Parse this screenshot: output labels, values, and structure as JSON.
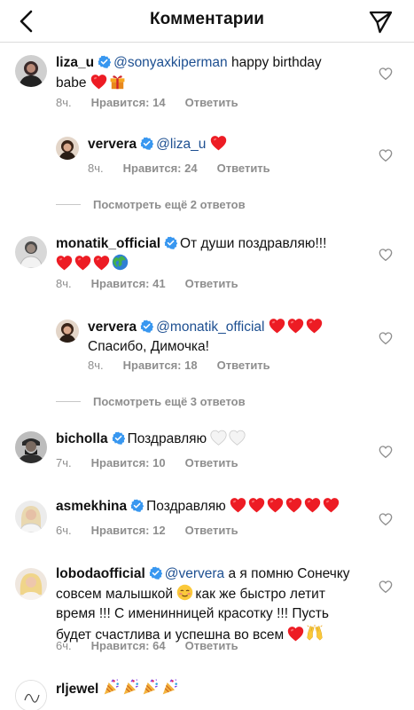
{
  "header": {
    "title": "Комментарии",
    "back_icon": "back-arrow-icon",
    "send_icon": "paper-plane-icon"
  },
  "comments": [
    {
      "username": "liza_u",
      "mention": "@sonyaxkiperman",
      "text": "happy birthday",
      "text2": "babe",
      "time": "8ч.",
      "likes": "Нравится: 14",
      "reply": "Ответить"
    },
    {
      "username": "ververa",
      "mention": "@liza_u",
      "time": "8ч.",
      "likes": "Нравится: 24",
      "reply": "Ответить"
    },
    {
      "view_more": "Посмотреть ещё 2 ответов"
    },
    {
      "username": "monatik_official",
      "text": "От души поздравляю!!!",
      "time": "8ч.",
      "likes": "Нравится: 41",
      "reply": "Ответить"
    },
    {
      "username": "ververa",
      "mention": "@monatik_official",
      "text2": "Спасибо, Димочка!",
      "time": "8ч.",
      "likes": "Нравится: 18",
      "reply": "Ответить"
    },
    {
      "view_more": "Посмотреть ещё 3 ответов"
    },
    {
      "username": "bicholla",
      "text": "Поздравляю",
      "time": "7ч.",
      "likes": "Нравится: 10",
      "reply": "Ответить"
    },
    {
      "username": "asmekhina",
      "text": "Поздравляю",
      "time": "6ч.",
      "likes": "Нравится: 12",
      "reply": "Ответить"
    },
    {
      "username": "lobodaofficial",
      "mention": "@ververa",
      "text": "а я помню Сонечку",
      "text2": "совсем малышкой",
      "text2b": "как же быстро летит",
      "text3": "время !!! С именинницей красотку !!! Пусть",
      "text4": "будет счастлива и успешна во всем",
      "time": "6ч.",
      "likes": "Нравится: 64",
      "reply": "Ответить"
    },
    {
      "username": "rljewel"
    }
  ],
  "colors": {
    "mention": "#1d4f91",
    "verified": "#3897f0",
    "heart": "#ed1c24",
    "meta": "#8e8e8e"
  }
}
